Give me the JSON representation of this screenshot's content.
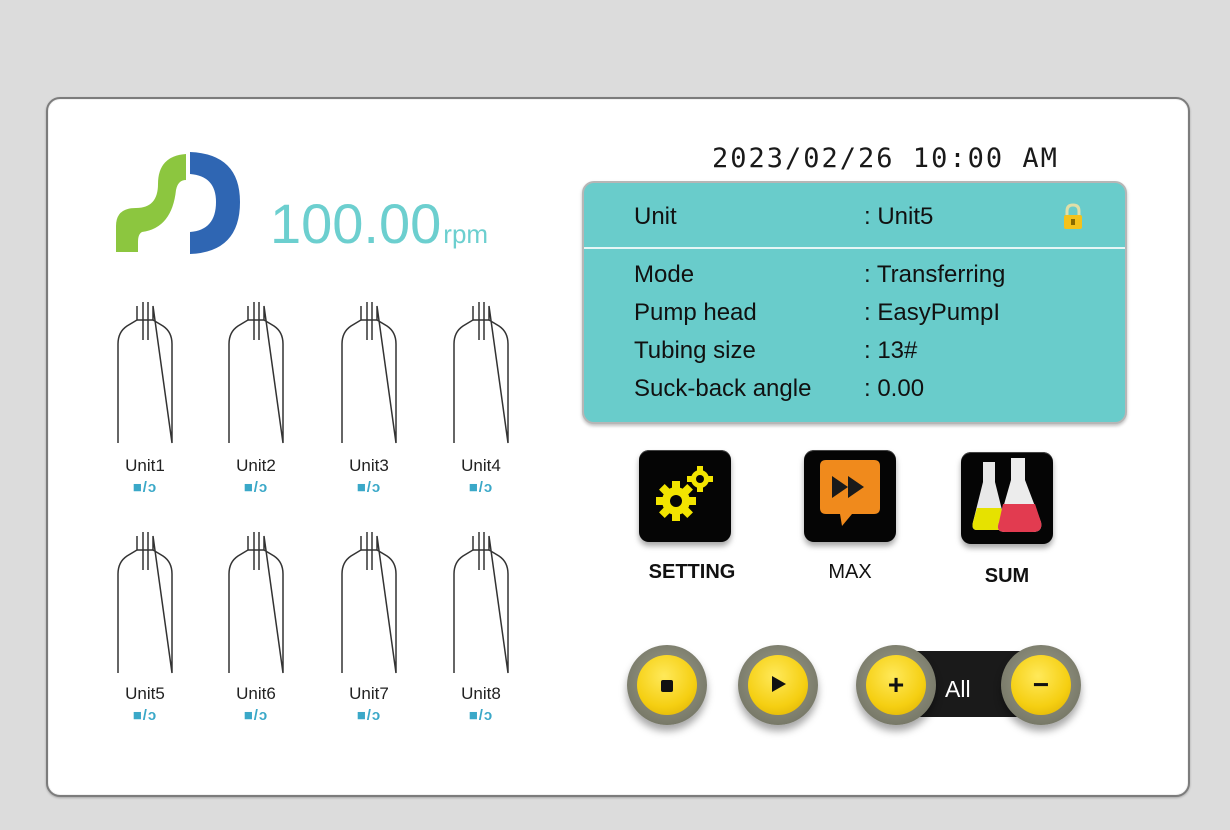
{
  "header": {
    "datetime": "2023/02/26 10:00 AM"
  },
  "speed": {
    "value": "100.00",
    "unit": "rpm"
  },
  "units": [
    {
      "label": "Unit1",
      "status": "■/ↄ"
    },
    {
      "label": "Unit2",
      "status": "■/ↄ"
    },
    {
      "label": "Unit3",
      "status": "■/ↄ"
    },
    {
      "label": "Unit4",
      "status": "■/ↄ"
    },
    {
      "label": "Unit5",
      "status": "■/ↄ"
    },
    {
      "label": "Unit6",
      "status": "■/ↄ"
    },
    {
      "label": "Unit7",
      "status": "■/ↄ"
    },
    {
      "label": "Unit8",
      "status": "■/ↄ"
    }
  ],
  "info_panel": {
    "unit_key": "Unit",
    "unit_value": ": Unit5",
    "rows": [
      {
        "key": "Mode",
        "value": ": Transferring"
      },
      {
        "key": "Pump head",
        "value": ": EasyPumpI"
      },
      {
        "key": "Tubing size",
        "value": ": 13#"
      },
      {
        "key": "Suck-back angle",
        "value": ": 0.00"
      }
    ],
    "lock_icon": "lock-icon"
  },
  "actions": [
    {
      "label": "SETTING",
      "icon": "gears-icon"
    },
    {
      "label": "MAX",
      "icon": "fast-forward-icon"
    },
    {
      "label": "SUM",
      "icon": "flasks-icon"
    }
  ],
  "controls": {
    "stop_icon": "stop-icon",
    "play_icon": "play-icon",
    "plus_label": "+",
    "minus_label": "−",
    "target_label": "All"
  },
  "colors": {
    "accent": "#69cccb",
    "speed_text": "#6ccfcf",
    "button_yellow": "#f5cf12",
    "status_blue": "#3aa8c8"
  }
}
